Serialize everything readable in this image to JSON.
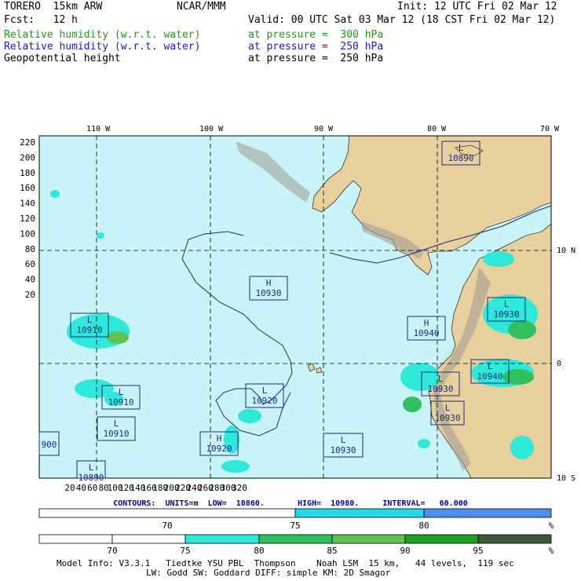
{
  "header": {
    "model": "TORERO  15km ARW",
    "org": "NCAR/MMM",
    "init": "Init: 12 UTC Fri 02 Mar 12",
    "fcst": "Fcst:   12 h",
    "valid": "Valid: 00 UTC Sat 03 Mar 12 (18 CST Fri 02 Mar 12)",
    "fields": [
      {
        "name": "Relative humidity (w.r.t. water)",
        "level": "at pressure =  300 hPa",
        "color": "#1a9a1a"
      },
      {
        "name": "Relative humidity (w.r.t. water)",
        "level": "at pressure =  250 hPa",
        "color": "#2020c0"
      },
      {
        "name": "Geopotential height",
        "level": "at pressure =  250 hPa",
        "color": "#000000"
      }
    ]
  },
  "map": {
    "lon_labels": [
      "110 W",
      "100 W",
      "90 W",
      "80 W",
      "70 W"
    ],
    "lat_labels": [
      "10 N",
      "0",
      "10 S"
    ],
    "x_ticks": [
      "20",
      "40",
      "60",
      "80",
      "100",
      "120",
      "140",
      "160",
      "180",
      "200",
      "220",
      "240",
      "260",
      "280",
      "300",
      "320"
    ],
    "y_ticks": [
      "220",
      "200",
      "180",
      "160",
      "140",
      "120",
      "100",
      "80",
      "60",
      "40",
      "20"
    ],
    "centers": [
      {
        "type": "L",
        "value": "10890"
      },
      {
        "type": "H",
        "value": "10930"
      },
      {
        "type": "L",
        "value": "10910"
      },
      {
        "type": "H",
        "value": "10940"
      },
      {
        "type": "L",
        "value": "10930"
      },
      {
        "type": "L",
        "value": "10930"
      },
      {
        "type": "L",
        "value": "10940"
      },
      {
        "type": "L",
        "value": "10910"
      },
      {
        "type": "L",
        "value": "10920"
      },
      {
        "type": "L",
        "value": "10930"
      },
      {
        "type": "L",
        "value": "10910"
      },
      {
        "type": "H",
        "value": "10920"
      },
      {
        "type": "L",
        "value": "10930"
      },
      {
        "type": "",
        "value": "900"
      },
      {
        "type": "L",
        "value": "10890"
      }
    ]
  },
  "contours": "CONTOURS:  UNITS=m  LOW=  10860.       HIGH=  10980.     INTERVAL=   60.000",
  "colorbar1": {
    "labels": [
      "70",
      "75",
      "80",
      "%"
    ],
    "colors": [
      "#ffffff",
      "#24d8e8",
      "#4f8ef0"
    ]
  },
  "colorbar2": {
    "labels": [
      "70",
      "75",
      "80",
      "85",
      "90",
      "95",
      "%"
    ],
    "colors": [
      "#ffffff",
      "#ffffff",
      "#2ee8d8",
      "#30c060",
      "#60c050",
      "#20a020",
      "#3f5a3a"
    ]
  },
  "footer": {
    "line1": "Model Info: V3.3.1   Tiedtke YSU PBL  Thompson    Noah LSM  15 km,   44 levels,  119 sec",
    "line2": "LW: Godd SW: Goddard DIFF: simple KM: 2D Smagor"
  }
}
